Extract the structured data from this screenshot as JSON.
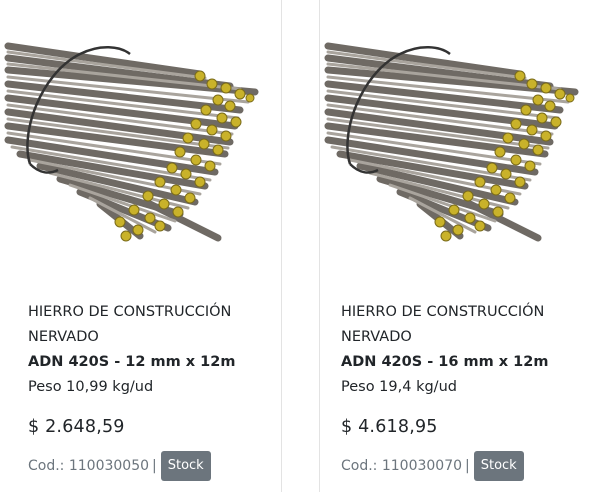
{
  "products": [
    {
      "name": "HIERRO DE CONSTRUCCIÓN NERVADO",
      "spec": "ADN 420S - 12 mm x 12m",
      "weight": "Peso 10,99 kg/ud",
      "price": "$ 2.648,59",
      "code": "Cod.: 110030050",
      "separator": "|",
      "stock_label": "Stock",
      "image_icon": "rebar-bundle-image"
    },
    {
      "name": "HIERRO DE CONSTRUCCIÓN NERVADO",
      "spec": "ADN 420S - 16 mm x 12m",
      "weight": "Peso 19,4 kg/ud",
      "price": "$ 4.618,95",
      "code": "Cod.: 110030070",
      "separator": "|",
      "stock_label": "Stock",
      "image_icon": "rebar-bundle-image"
    }
  ],
  "colors": {
    "stock_button_bg": "#6c757d",
    "code_text": "#6c757d",
    "rebar_steel": "#8a8580",
    "rebar_end_yellow": "#c9b22a"
  }
}
